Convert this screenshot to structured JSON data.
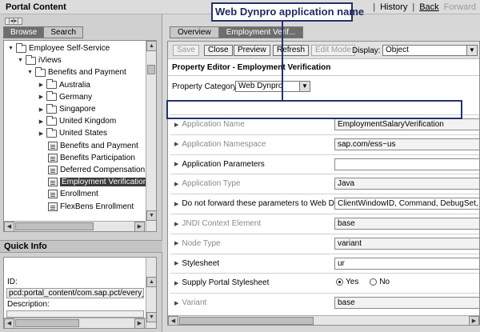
{
  "top": {
    "title": "Portal Content",
    "nav": {
      "history": "History",
      "back": "Back",
      "forward": "Forward"
    }
  },
  "left": {
    "mini_toolbar": "|◂|▸|",
    "tabs": [
      "Browse",
      "Search"
    ],
    "tree": [
      {
        "label": "Employee Self-Service",
        "toggle": "▼",
        "icon": "folder-icon",
        "depth": 0
      },
      {
        "label": "iViews",
        "toggle": "▼",
        "icon": "folder-icon",
        "depth": 1
      },
      {
        "label": "Benefits and Payment",
        "toggle": "▼",
        "icon": "folder-icon",
        "depth": 2
      },
      {
        "label": "Australia",
        "toggle": "▶",
        "icon": "folder-icon",
        "depth": 3
      },
      {
        "label": "Germany",
        "toggle": "▶",
        "icon": "folder-icon",
        "depth": 3
      },
      {
        "label": "Singapore",
        "toggle": "▶",
        "icon": "folder-icon",
        "depth": 3
      },
      {
        "label": "United Kingdom",
        "toggle": "▶",
        "icon": "folder-icon",
        "depth": 3
      },
      {
        "label": "United States",
        "toggle": "▶",
        "icon": "folder-icon",
        "depth": 3
      },
      {
        "label": "Benefits and Payment",
        "toggle": "",
        "icon": "iview-icon",
        "depth": 3
      },
      {
        "label": "Benefits Participation",
        "toggle": "",
        "icon": "iview-icon",
        "depth": 3
      },
      {
        "label": "Deferred Compensation",
        "toggle": "",
        "icon": "iview-icon",
        "depth": 3
      },
      {
        "label": "Employment Verification",
        "toggle": "",
        "icon": "iview-icon",
        "depth": 3,
        "selected": true
      },
      {
        "label": "Enrollment",
        "toggle": "",
        "icon": "iview-icon",
        "depth": 3
      },
      {
        "label": "FlexBens Enrollment",
        "toggle": "",
        "icon": "iview-icon",
        "depth": 3
      }
    ],
    "quickinfo": {
      "title": "Quick Info",
      "id_label": "ID:",
      "id_value": "pcd:portal_content/com.sap.pct/every_use",
      "desc_label": "Description:",
      "desc_value": ""
    }
  },
  "right": {
    "tabs": [
      "Overview",
      "Employment Verif..."
    ],
    "toolbar": {
      "save": "Save",
      "close": "Close",
      "preview": "Preview",
      "refresh": "Refresh",
      "edit_mode": "Edit Mode",
      "display_label": "Display:",
      "display_value": "Object"
    },
    "editor_title": "Property Editor - Employment Verification",
    "category_label": "Property Category:",
    "category_value": "Web Dynpro",
    "properties": [
      {
        "name": "Application Name",
        "value": "EmploymentSalaryVerification",
        "greyed": true,
        "editable": false
      },
      {
        "name": "Application Namespace",
        "value": "sap.com/ess~us",
        "greyed": true,
        "editable": false
      },
      {
        "name": "Application Parameters",
        "value": "",
        "greyed": false,
        "editable": true
      },
      {
        "name": "Application Type",
        "value": "Java",
        "greyed": true,
        "editable": false
      },
      {
        "name": "Do not forward these parameters to Web Dynpro",
        "value": "ClientWindowID, Command, DebugSet, DynamicParameter",
        "greyed": false,
        "editable": true
      },
      {
        "name": "JNDI Context Element",
        "value": "base",
        "greyed": true,
        "editable": false
      },
      {
        "name": "Node Type",
        "value": "variant",
        "greyed": true,
        "editable": false
      },
      {
        "name": "Stylesheet",
        "value": "ur",
        "greyed": false,
        "editable": true
      },
      {
        "name": "Supply Portal Stylesheet",
        "value": "",
        "greyed": false,
        "editable": true,
        "radio": true
      },
      {
        "name": "Variant",
        "value": "base",
        "greyed": true,
        "editable": false
      }
    ],
    "radio": {
      "yes": "Yes",
      "no": "No",
      "selected": "yes"
    }
  },
  "annotation": {
    "callout": "Web Dynpro application name",
    "color": "#23326b"
  }
}
